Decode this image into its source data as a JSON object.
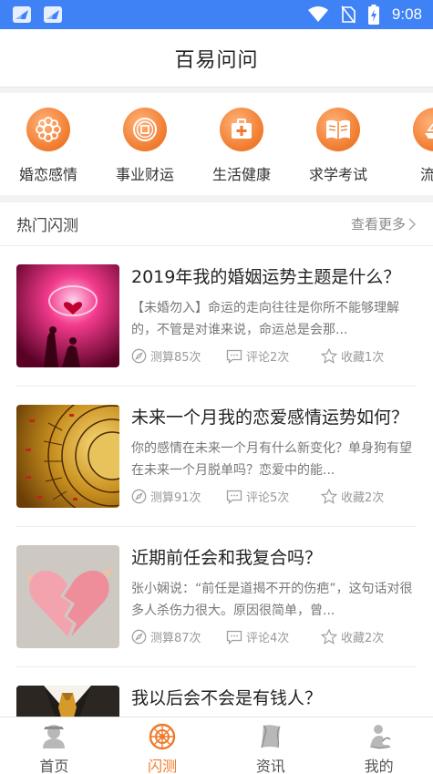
{
  "status_bar": {
    "time": "9:08",
    "icons": [
      "app-notification-icon",
      "app-notification-icon",
      "wifi-icon",
      "no-sim-icon",
      "battery-charging-icon"
    ]
  },
  "header": {
    "title": "百易问问"
  },
  "categories": [
    {
      "label": "婚恋感情",
      "icon": "flower-emblem-icon"
    },
    {
      "label": "事业财运",
      "icon": "coin-icon"
    },
    {
      "label": "生活健康",
      "icon": "medical-kit-icon"
    },
    {
      "label": "求学考试",
      "icon": "book-icon"
    },
    {
      "label": "流年",
      "icon": "ship-icon"
    }
  ],
  "hot_section": {
    "title": "热门闪测",
    "more_label": "查看更多"
  },
  "articles": [
    {
      "title": "2019年我的婚姻运势主题是什么？",
      "description": "【未婚勿入】命运的走向往往是你所不能够理解的，不管是对谁来说，命运总是会那...",
      "tests": "测算85次",
      "comments": "评论2次",
      "favorites": "收藏1次"
    },
    {
      "title": "未来一个月我的恋爱感情运势如何？",
      "description": "你的感情在未来一个月有什么新变化？单身狗有望在未来一个月脱单吗？恋爱中的能...",
      "tests": "测算91次",
      "comments": "评论5次",
      "favorites": "收藏2次"
    },
    {
      "title": "近期前任会和我复合吗？",
      "description": "张小娴说：“前任是道揭不开的伤疤”，这句话对很多人杀伤力很大。原因很简单，曾...",
      "tests": "测算87次",
      "comments": "评论4次",
      "favorites": "收藏2次"
    },
    {
      "title": "我以后会不会是有钱人？",
      "description": "",
      "tests": "",
      "comments": "",
      "favorites": ""
    }
  ],
  "bottom_nav": [
    {
      "label": "首页",
      "icon": "home-avatar-icon",
      "active": false
    },
    {
      "label": "闪测",
      "icon": "flash-test-icon",
      "active": true
    },
    {
      "label": "资讯",
      "icon": "news-icon",
      "active": false
    },
    {
      "label": "我的",
      "icon": "profile-icon",
      "active": false
    }
  ],
  "colors": {
    "status_bar": "#3f82f5",
    "accent": "#ef7a2b",
    "icon_orange": "#f07a2c"
  }
}
